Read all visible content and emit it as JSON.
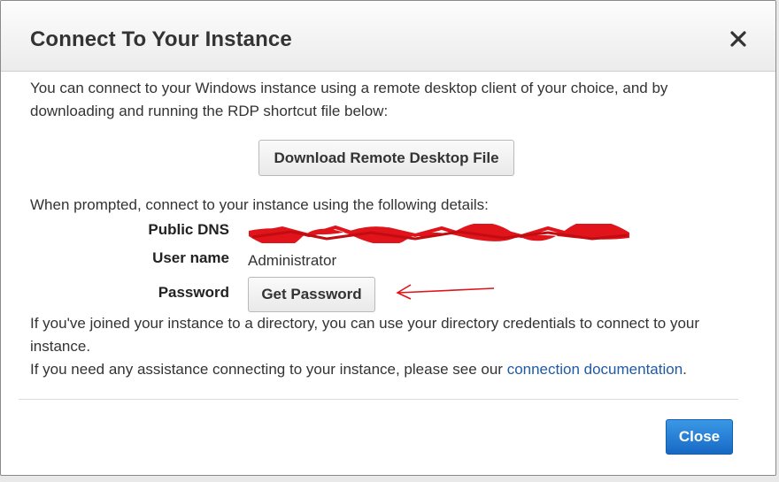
{
  "dialog": {
    "title": "Connect To Your Instance",
    "close_icon": "close-icon"
  },
  "intro": {
    "line1": "You can connect to your Windows instance using a remote desktop client of your choice, and by",
    "line2": "downloading and running the RDP shortcut file below:"
  },
  "download_button": {
    "label": "Download Remote Desktop File"
  },
  "details": {
    "prompt": "When prompted, connect to your instance using the following details:",
    "public_dns_label": "Public DNS",
    "user_name_label": "User name",
    "user_name_value": "Administrator",
    "password_label": "Password",
    "get_password_label": "Get Password"
  },
  "directory_note": {
    "line1": "If you've joined your instance to a directory, you can use your directory credentials to connect to your",
    "line2": "instance."
  },
  "assistance": {
    "text": "If you need any assistance connecting to your instance, please see our",
    "link": "connection documentation",
    "period": "."
  },
  "footer": {
    "close_label": "Close"
  },
  "colors": {
    "primary_button": "#1f74d0",
    "link": "#1f5aa6",
    "annotation_red": "#e0141a"
  }
}
